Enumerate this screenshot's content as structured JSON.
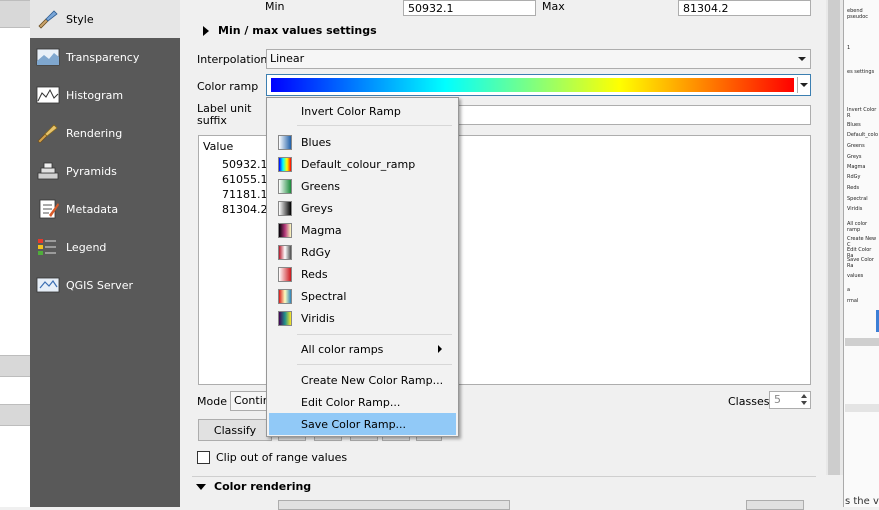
{
  "sidebar": {
    "items": [
      {
        "label": "Style",
        "icon": "style-brush-icon"
      },
      {
        "label": "Transparency",
        "icon": "transparency-icon"
      },
      {
        "label": "Histogram",
        "icon": "histogram-icon"
      },
      {
        "label": "Rendering",
        "icon": "rendering-brush-icon"
      },
      {
        "label": "Pyramids",
        "icon": "pyramids-icon"
      },
      {
        "label": "Metadata",
        "icon": "metadata-icon"
      },
      {
        "label": "Legend",
        "icon": "legend-icon"
      },
      {
        "label": "QGIS Server",
        "icon": "qgis-server-icon"
      }
    ],
    "active_index": 0
  },
  "minmax": {
    "min_label": "Min",
    "min_value": "50932.1",
    "max_label": "Max",
    "max_value": "81304.2"
  },
  "sections": {
    "minmax_settings": "Min / max values settings",
    "color_rendering": "Color rendering"
  },
  "interpolation": {
    "label": "Interpolation",
    "value": "Linear"
  },
  "color_ramp": {
    "label": "Color ramp"
  },
  "label_unit": {
    "label_line1": "Label unit",
    "label_line2": "suffix"
  },
  "value_list": {
    "header": "Value",
    "values": [
      "50932.1",
      "61055.12",
      "71181.17",
      "81304.2"
    ]
  },
  "mode": {
    "label": "Mode",
    "value": "Continu"
  },
  "classes": {
    "label": "Classes",
    "value": "5"
  },
  "classify_button": "Classify",
  "clip_checkbox": {
    "label": "Clip out of range values",
    "checked": false
  },
  "menu": {
    "invert": "Invert Color Ramp",
    "ramps": [
      {
        "label": "Blues",
        "gradient": [
          "#ffffff",
          "#1f5fa8"
        ]
      },
      {
        "label": "Default_colour_ramp",
        "gradient": [
          "#0000ff",
          "#00ffff",
          "#ffff00",
          "#ff0000"
        ]
      },
      {
        "label": "Greens",
        "gradient": [
          "#ffffff",
          "#1a8a3a"
        ]
      },
      {
        "label": "Greys",
        "gradient": [
          "#ffffff",
          "#000000"
        ]
      },
      {
        "label": "Magma",
        "gradient": [
          "#000004",
          "#b5367a",
          "#fcfdbf"
        ]
      },
      {
        "label": "RdGy",
        "gradient": [
          "#b2182b",
          "#ffffff",
          "#4d4d4d"
        ]
      },
      {
        "label": "Reds",
        "gradient": [
          "#ffffff",
          "#cb181d"
        ]
      },
      {
        "label": "Spectral",
        "gradient": [
          "#d7191c",
          "#ffffbf",
          "#2b83ba"
        ]
      },
      {
        "label": "Viridis",
        "gradient": [
          "#440154",
          "#21918c",
          "#fde725"
        ]
      }
    ],
    "all_ramps": "All color ramps",
    "create": "Create New Color Ramp...",
    "edit": "Edit Color Ramp...",
    "save": "Save Color Ramp...",
    "highlighted": "save"
  },
  "right_panel": {
    "texts": [
      "ebend pseudoc",
      "1",
      "es settings",
      "Invert Color R",
      "Blues",
      "Default_colo",
      "Greens",
      "Greys",
      "Magma",
      "RdGy",
      "Reds",
      "Spectral",
      "Viridis",
      "All color ramp",
      "Create New C",
      "Edit Color Ra",
      "Save Color Ra",
      "values",
      "a",
      "rmal",
      "Colorize"
    ],
    "bottom_text": "s the v"
  },
  "colors": {
    "sidebar_bg": "#595959",
    "accent_highlight": "#91c9f7",
    "ramp": [
      "#0000ff",
      "#00ffff",
      "#ffff00",
      "#ff0000"
    ]
  }
}
